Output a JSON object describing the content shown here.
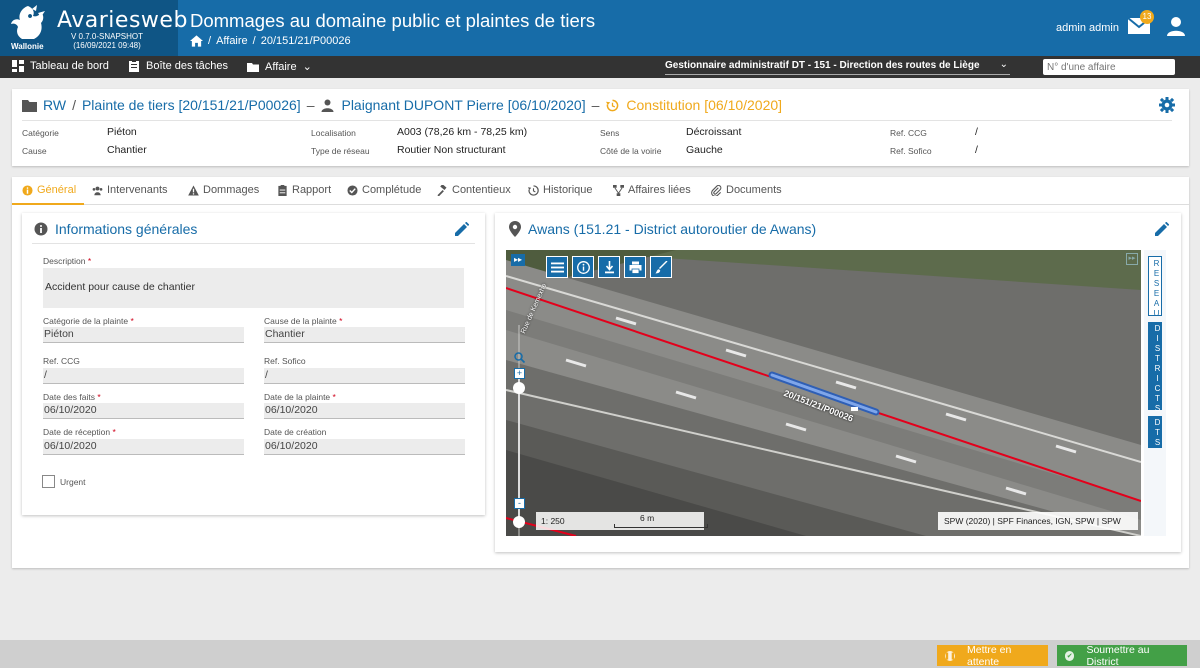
{
  "header": {
    "brand_name": "Avariesweb",
    "brand_sub": "Wallonie",
    "version_line1": "V 0.7.0-SNAPSHOT",
    "version_line2": "(16/09/2021 09:48)",
    "app_title": "Dommages au domaine public et plaintes de tiers",
    "breadcrumb": {
      "sep": "/",
      "level1": "Affaire",
      "level2": "20/151/21/P00026"
    },
    "user_name": "admin admin",
    "mail_count": "13",
    "colors": {
      "primary": "#176ca8",
      "brand_bg": "#0f5585",
      "accent": "#f0a91c",
      "success": "#43a047"
    }
  },
  "menubar": {
    "dashboard": "Tableau de bord",
    "tasks": "Boîte des tâches",
    "affaire": "Affaire",
    "gestionnaire": "Gestionnaire administratif DT - 151 - Direction des routes de Liège",
    "search_placeholder": "N° d'une affaire"
  },
  "affaire": {
    "path": {
      "rw": "RW",
      "plainte": "Plainte de tiers [20/151/21/P00026]",
      "plaignant": "Plaignant DUPONT Pierre [06/10/2020]",
      "constitution": "Constitution [06/10/2020]",
      "sep_slash": "/",
      "sep_dash": "–"
    },
    "fields": {
      "categorie_label": "Catégorie",
      "categorie": "Piéton",
      "cause_label": "Cause",
      "cause": "Chantier",
      "localisation_label": "Localisation",
      "localisation": "A003 (78,26 km - 78,25 km)",
      "type_reseau_label": "Type de réseau",
      "type_reseau": "Routier Non structurant",
      "sens_label": "Sens",
      "sens": "Décroissant",
      "cote_label": "Côté de la voirie",
      "cote": "Gauche",
      "ref_ccg_label": "Ref. CCG",
      "ref_ccg": "/",
      "ref_sofico_label": "Ref. Sofico",
      "ref_sofico": "/"
    }
  },
  "tabs": [
    {
      "label": "Général",
      "icon": "info-icon"
    },
    {
      "label": "Intervenants",
      "icon": "users-icon"
    },
    {
      "label": "Dommages",
      "icon": "warning-icon"
    },
    {
      "label": "Rapport",
      "icon": "clipboard-icon"
    },
    {
      "label": "Complétude",
      "icon": "check-circle-icon"
    },
    {
      "label": "Contentieux",
      "icon": "gavel-icon"
    },
    {
      "label": "Historique",
      "icon": "history-icon"
    },
    {
      "label": "Affaires liées",
      "icon": "sitemap-icon"
    },
    {
      "label": "Documents",
      "icon": "paperclip-icon"
    }
  ],
  "info": {
    "title": "Informations générales",
    "required_mark": "*",
    "description_label": "Description",
    "description": "Accident pour cause de chantier",
    "categorie_label": "Catégorie de la plainte",
    "categorie": "Piéton",
    "cause_label": "Cause de la plainte",
    "cause": "Chantier",
    "ref_ccg_label": "Ref. CCG",
    "ref_ccg": "/",
    "ref_sofico_label": "Ref. Sofico",
    "ref_sofico": "/",
    "date_faits_label": "Date des faits",
    "date_faits": "06/10/2020",
    "date_plainte_label": "Date de la plainte",
    "date_plainte": "06/10/2020",
    "date_reception_label": "Date de réception",
    "date_reception": "06/10/2020",
    "date_creation_label": "Date de création",
    "date_creation": "06/10/2020",
    "urgent_label": "Urgent"
  },
  "map": {
    "title": "Awans (151.21 - District autoroutier de Awans)",
    "segment_label": "20/151/21/P00026",
    "road_label": "Rue de Kemexhe",
    "scale_ratio": "1: 250",
    "scale_length": "6 m",
    "attribution": "SPW (2020) | SPF Finances, IGN, SPW | SPW",
    "zoom_in": "+",
    "zoom_out": "-",
    "layers": [
      "RESEAU",
      "DISTRICTS",
      "DTS"
    ]
  },
  "footer": {
    "wait_label": "Mettre en attente",
    "submit_label": "Soumettre au District"
  }
}
